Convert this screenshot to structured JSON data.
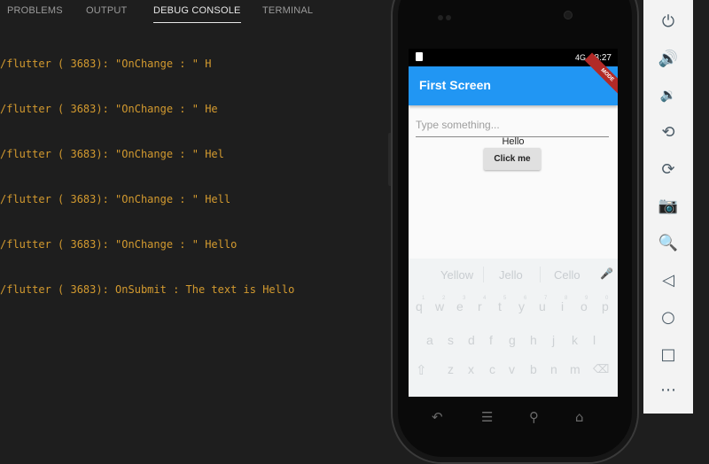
{
  "panel": {
    "tabs": [
      {
        "label": "PROBLEMS"
      },
      {
        "label": "OUTPUT"
      },
      {
        "label": "DEBUG CONSOLE"
      },
      {
        "label": "TERMINAL"
      }
    ],
    "active_tab": "DEBUG CONSOLE",
    "console_lines": [
      "/flutter ( 3683): \"OnChange : \" H",
      "/flutter ( 3683): \"OnChange : \" He",
      "/flutter ( 3683): \"OnChange : \" Hel",
      "/flutter ( 3683): \"OnChange : \" Hell",
      "/flutter ( 3683): \"OnChange : \" Hello",
      "/flutter ( 3683): OnSubmit : The text is Hello"
    ]
  },
  "phone": {
    "status": {
      "signal": "4G",
      "time": "8:27"
    },
    "debug_banner": "MODE",
    "appbar_title": "First Screen",
    "text_field": {
      "placeholder": "Type something...",
      "value": ""
    },
    "output_text": "Hello",
    "button_label": "Click me",
    "keyboard": {
      "suggestions": [
        "Yellow",
        "Jello",
        "Cello"
      ],
      "row1": [
        "q",
        "w",
        "e",
        "r",
        "t",
        "y",
        "u",
        "i",
        "o",
        "p"
      ],
      "row1_hints": [
        "1",
        "2",
        "3",
        "4",
        "5",
        "6",
        "7",
        "8",
        "9",
        "0"
      ],
      "row2": [
        "a",
        "s",
        "d",
        "f",
        "g",
        "h",
        "j",
        "k",
        "l"
      ],
      "row3": [
        "z",
        "x",
        "c",
        "v",
        "b",
        "n",
        "m"
      ]
    },
    "nav_buttons": [
      "back-icon",
      "menu-icon",
      "search-icon",
      "home-icon"
    ]
  },
  "toolbar": {
    "icons": [
      "power-icon",
      "volume-up-icon",
      "volume-down-icon",
      "rotate-left-icon",
      "rotate-right-icon",
      "camera-icon",
      "zoom-icon",
      "back-icon",
      "home-icon",
      "overview-icon",
      "more-icon"
    ]
  },
  "colors": {
    "console_text": "#d39a2f",
    "appbar": "#2196f3",
    "background": "#1e1e1e"
  }
}
